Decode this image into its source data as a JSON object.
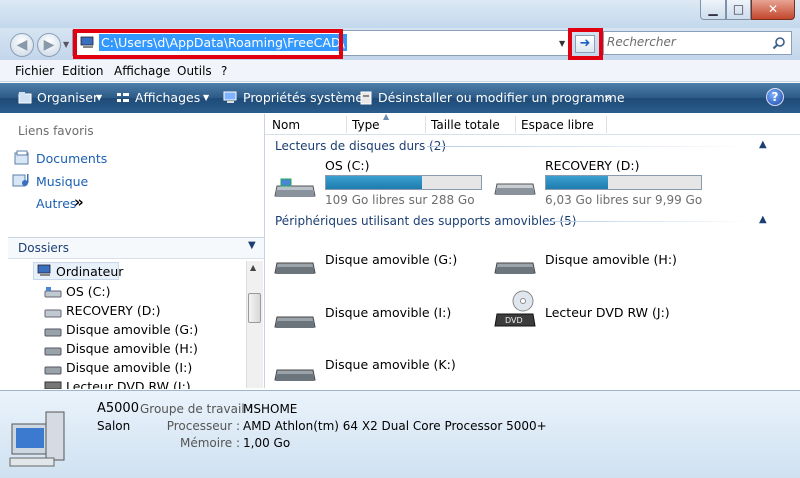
{
  "address": {
    "path": "C:\\Users\\d\\AppData\\Roaming\\FreeCAD\\"
  },
  "search": {
    "placeholder": "Rechercher"
  },
  "menu": [
    "Fichier",
    "Edition",
    "Affichage",
    "Outils",
    "?"
  ],
  "toolbar": {
    "organize": "Organiser",
    "views": "Affichages",
    "system_properties": "Propriétés système",
    "uninstall": "Désinstaller ou modifier un programme",
    "more": "»"
  },
  "favorites": {
    "title": "Liens favoris",
    "items": [
      "Documents",
      "Musique"
    ],
    "more": "Autres",
    "more_glyph": "»"
  },
  "folders": {
    "title": "Dossiers",
    "tree": [
      "Ordinateur",
      "OS (C:)",
      "RECOVERY (D:)",
      "Disque amovible (G:)",
      "Disque amovible (H:)",
      "Disque amovible (I:)",
      "Lecteur DVD RW (J:)"
    ]
  },
  "columns": [
    "Nom",
    "Type",
    "Taille totale",
    "Espace libre"
  ],
  "groups": {
    "hard_drives": {
      "title": "Lecteurs de disques durs (2)",
      "items": [
        {
          "name": "OS (C:)",
          "info": "109 Go libres sur 288 Go",
          "used_fraction": 0.62
        },
        {
          "name": "RECOVERY (D:)",
          "info": "6,03 Go libres sur 9,99 Go",
          "used_fraction": 0.4
        }
      ]
    },
    "removable": {
      "title": "Périphériques utilisant des supports amovibles (5)",
      "items": [
        "Disque amovible (G:)",
        "Disque amovible (H:)",
        "Disque amovible (I:)",
        "Lecteur DVD RW (J:)",
        "Disque amovible (K:)"
      ]
    }
  },
  "details": {
    "computer_name": "A5000",
    "description": "Salon",
    "workgroup_label": "Groupe de travail :",
    "workgroup": "MSHOME",
    "processor_label": "Processeur :",
    "processor": "AMD Athlon(tm) 64 X2 Dual Core Processor 5000+",
    "memory_label": "Mémoire :",
    "memory": "1,00 Go"
  },
  "colors": {
    "highlight_red": "#e00010",
    "selection_blue": "#3399ff",
    "command_bar": "#2c5a86",
    "link_blue": "#1a5fb4"
  }
}
